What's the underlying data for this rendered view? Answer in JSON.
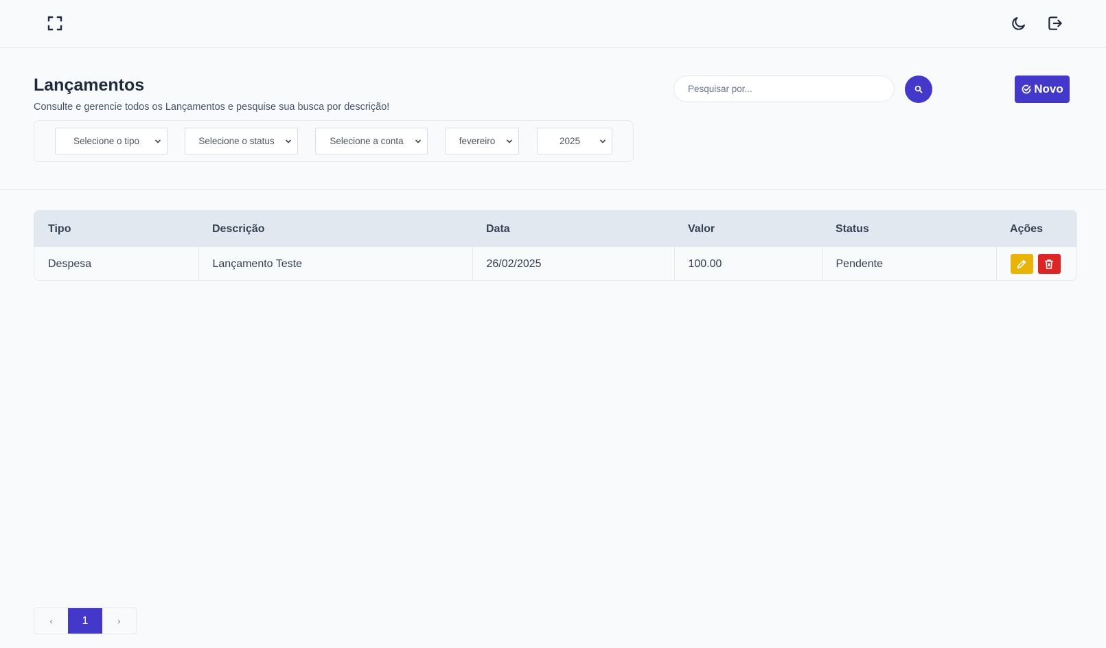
{
  "topbar": {
    "left_icon": "fullscreen-icon",
    "right_icons": [
      "moon-icon",
      "logout-icon"
    ]
  },
  "header": {
    "title": "Lançamentos",
    "subtitle": "Consulte e gerencie todos os Lançamentos e pesquise sua busca por descrição!"
  },
  "filters": {
    "tipo": "Selecione o tipo",
    "status": "Selecione o status",
    "conta": "Selecione a conta",
    "mes": "fevereiro",
    "ano": "2025"
  },
  "search": {
    "placeholder": "Pesquisar por...",
    "icon": "search-icon"
  },
  "new_button": {
    "label": "Novo",
    "icon": "check-circle-icon"
  },
  "table": {
    "headers": [
      "Tipo",
      "Descrição",
      "Data",
      "Valor",
      "Status",
      "Ações"
    ],
    "rows": [
      {
        "tipo": "Despesa",
        "descricao": "Lançamento Teste",
        "data": "26/02/2025",
        "valor": "100.00",
        "status": "Pendente"
      }
    ]
  },
  "pagination": {
    "prev": "‹",
    "current": "1",
    "next": "›"
  },
  "colors": {
    "primary": "#4338ca",
    "edit": "#eab308",
    "delete": "#dc2626",
    "background": "#f8fafc",
    "header_row": "#e2e8f0"
  }
}
